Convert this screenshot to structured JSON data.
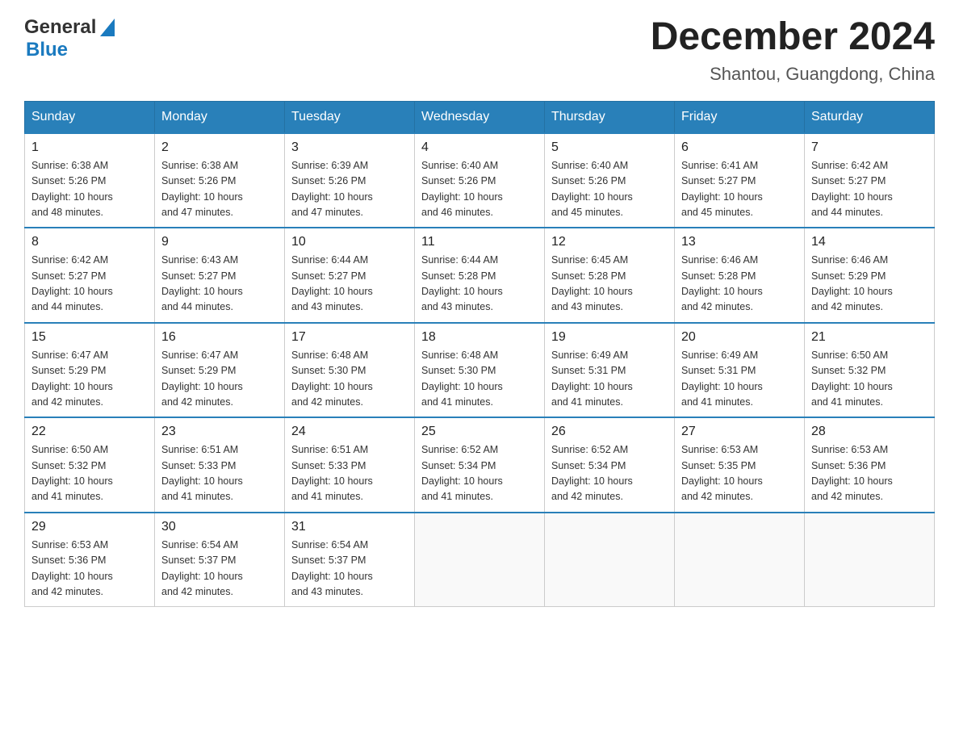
{
  "header": {
    "logo_general": "General",
    "logo_blue": "Blue",
    "title": "December 2024",
    "subtitle": "Shantou, Guangdong, China"
  },
  "days_of_week": [
    "Sunday",
    "Monday",
    "Tuesday",
    "Wednesday",
    "Thursday",
    "Friday",
    "Saturday"
  ],
  "weeks": [
    [
      {
        "day": "1",
        "sunrise": "6:38 AM",
        "sunset": "5:26 PM",
        "daylight": "10 hours and 48 minutes."
      },
      {
        "day": "2",
        "sunrise": "6:38 AM",
        "sunset": "5:26 PM",
        "daylight": "10 hours and 47 minutes."
      },
      {
        "day": "3",
        "sunrise": "6:39 AM",
        "sunset": "5:26 PM",
        "daylight": "10 hours and 47 minutes."
      },
      {
        "day": "4",
        "sunrise": "6:40 AM",
        "sunset": "5:26 PM",
        "daylight": "10 hours and 46 minutes."
      },
      {
        "day": "5",
        "sunrise": "6:40 AM",
        "sunset": "5:26 PM",
        "daylight": "10 hours and 45 minutes."
      },
      {
        "day": "6",
        "sunrise": "6:41 AM",
        "sunset": "5:27 PM",
        "daylight": "10 hours and 45 minutes."
      },
      {
        "day": "7",
        "sunrise": "6:42 AM",
        "sunset": "5:27 PM",
        "daylight": "10 hours and 44 minutes."
      }
    ],
    [
      {
        "day": "8",
        "sunrise": "6:42 AM",
        "sunset": "5:27 PM",
        "daylight": "10 hours and 44 minutes."
      },
      {
        "day": "9",
        "sunrise": "6:43 AM",
        "sunset": "5:27 PM",
        "daylight": "10 hours and 44 minutes."
      },
      {
        "day": "10",
        "sunrise": "6:44 AM",
        "sunset": "5:27 PM",
        "daylight": "10 hours and 43 minutes."
      },
      {
        "day": "11",
        "sunrise": "6:44 AM",
        "sunset": "5:28 PM",
        "daylight": "10 hours and 43 minutes."
      },
      {
        "day": "12",
        "sunrise": "6:45 AM",
        "sunset": "5:28 PM",
        "daylight": "10 hours and 43 minutes."
      },
      {
        "day": "13",
        "sunrise": "6:46 AM",
        "sunset": "5:28 PM",
        "daylight": "10 hours and 42 minutes."
      },
      {
        "day": "14",
        "sunrise": "6:46 AM",
        "sunset": "5:29 PM",
        "daylight": "10 hours and 42 minutes."
      }
    ],
    [
      {
        "day": "15",
        "sunrise": "6:47 AM",
        "sunset": "5:29 PM",
        "daylight": "10 hours and 42 minutes."
      },
      {
        "day": "16",
        "sunrise": "6:47 AM",
        "sunset": "5:29 PM",
        "daylight": "10 hours and 42 minutes."
      },
      {
        "day": "17",
        "sunrise": "6:48 AM",
        "sunset": "5:30 PM",
        "daylight": "10 hours and 42 minutes."
      },
      {
        "day": "18",
        "sunrise": "6:48 AM",
        "sunset": "5:30 PM",
        "daylight": "10 hours and 41 minutes."
      },
      {
        "day": "19",
        "sunrise": "6:49 AM",
        "sunset": "5:31 PM",
        "daylight": "10 hours and 41 minutes."
      },
      {
        "day": "20",
        "sunrise": "6:49 AM",
        "sunset": "5:31 PM",
        "daylight": "10 hours and 41 minutes."
      },
      {
        "day": "21",
        "sunrise": "6:50 AM",
        "sunset": "5:32 PM",
        "daylight": "10 hours and 41 minutes."
      }
    ],
    [
      {
        "day": "22",
        "sunrise": "6:50 AM",
        "sunset": "5:32 PM",
        "daylight": "10 hours and 41 minutes."
      },
      {
        "day": "23",
        "sunrise": "6:51 AM",
        "sunset": "5:33 PM",
        "daylight": "10 hours and 41 minutes."
      },
      {
        "day": "24",
        "sunrise": "6:51 AM",
        "sunset": "5:33 PM",
        "daylight": "10 hours and 41 minutes."
      },
      {
        "day": "25",
        "sunrise": "6:52 AM",
        "sunset": "5:34 PM",
        "daylight": "10 hours and 41 minutes."
      },
      {
        "day": "26",
        "sunrise": "6:52 AM",
        "sunset": "5:34 PM",
        "daylight": "10 hours and 42 minutes."
      },
      {
        "day": "27",
        "sunrise": "6:53 AM",
        "sunset": "5:35 PM",
        "daylight": "10 hours and 42 minutes."
      },
      {
        "day": "28",
        "sunrise": "6:53 AM",
        "sunset": "5:36 PM",
        "daylight": "10 hours and 42 minutes."
      }
    ],
    [
      {
        "day": "29",
        "sunrise": "6:53 AM",
        "sunset": "5:36 PM",
        "daylight": "10 hours and 42 minutes."
      },
      {
        "day": "30",
        "sunrise": "6:54 AM",
        "sunset": "5:37 PM",
        "daylight": "10 hours and 42 minutes."
      },
      {
        "day": "31",
        "sunrise": "6:54 AM",
        "sunset": "5:37 PM",
        "daylight": "10 hours and 43 minutes."
      },
      null,
      null,
      null,
      null
    ]
  ],
  "labels": {
    "sunrise": "Sunrise:",
    "sunset": "Sunset:",
    "daylight": "Daylight:"
  }
}
